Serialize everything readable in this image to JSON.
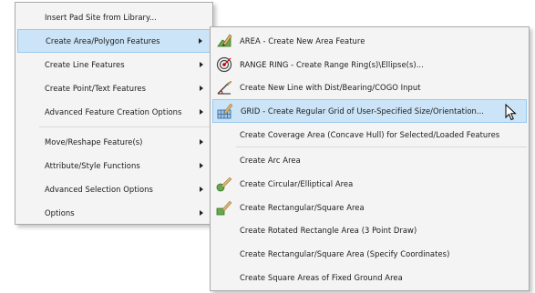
{
  "main_menu": {
    "items": [
      {
        "label": "Insert Pad Site from Library..."
      },
      {
        "label": "Create Area/Polygon Features"
      },
      {
        "label": "Create Line Features"
      },
      {
        "label": "Create Point/Text Features"
      },
      {
        "label": "Advanced Feature Creation Options"
      },
      {
        "label": "Move/Reshape Feature(s)"
      },
      {
        "label": "Attribute/Style Functions"
      },
      {
        "label": "Advanced Selection Options"
      },
      {
        "label": "Options"
      }
    ]
  },
  "sub_menu": {
    "items": [
      {
        "label": "AREA - Create New Area Feature",
        "icon": "area-draw-icon"
      },
      {
        "label": "RANGE RING - Create Range Ring(s)\\Ellipse(s)...",
        "icon": "range-ring-icon"
      },
      {
        "label": "Create New Line with Dist/Bearing/COGO Input",
        "icon": "cogo-line-icon"
      },
      {
        "label": "GRID - Create Regular Grid of User-Specified Size/Orientation...",
        "icon": "grid-icon"
      },
      {
        "label": "Create Coverage Area (Concave Hull) for Selected/Loaded Features"
      },
      {
        "label": "Create Arc Area"
      },
      {
        "label": "Create Circular/Elliptical Area",
        "icon": "circle-area-icon"
      },
      {
        "label": "Create Rectangular/Square Area",
        "icon": "rectangle-area-icon"
      },
      {
        "label": "Create Rotated Rectangle Area (3 Point Draw)"
      },
      {
        "label": "Create Rectangular/Square Area (Specify Coordinates)"
      },
      {
        "label": "Create Square Areas of Fixed Ground Area"
      }
    ]
  },
  "colors": {
    "highlight": "#cce4f7",
    "highlight_border": "#99c8ef",
    "menu_bg": "#f4f4f4"
  }
}
